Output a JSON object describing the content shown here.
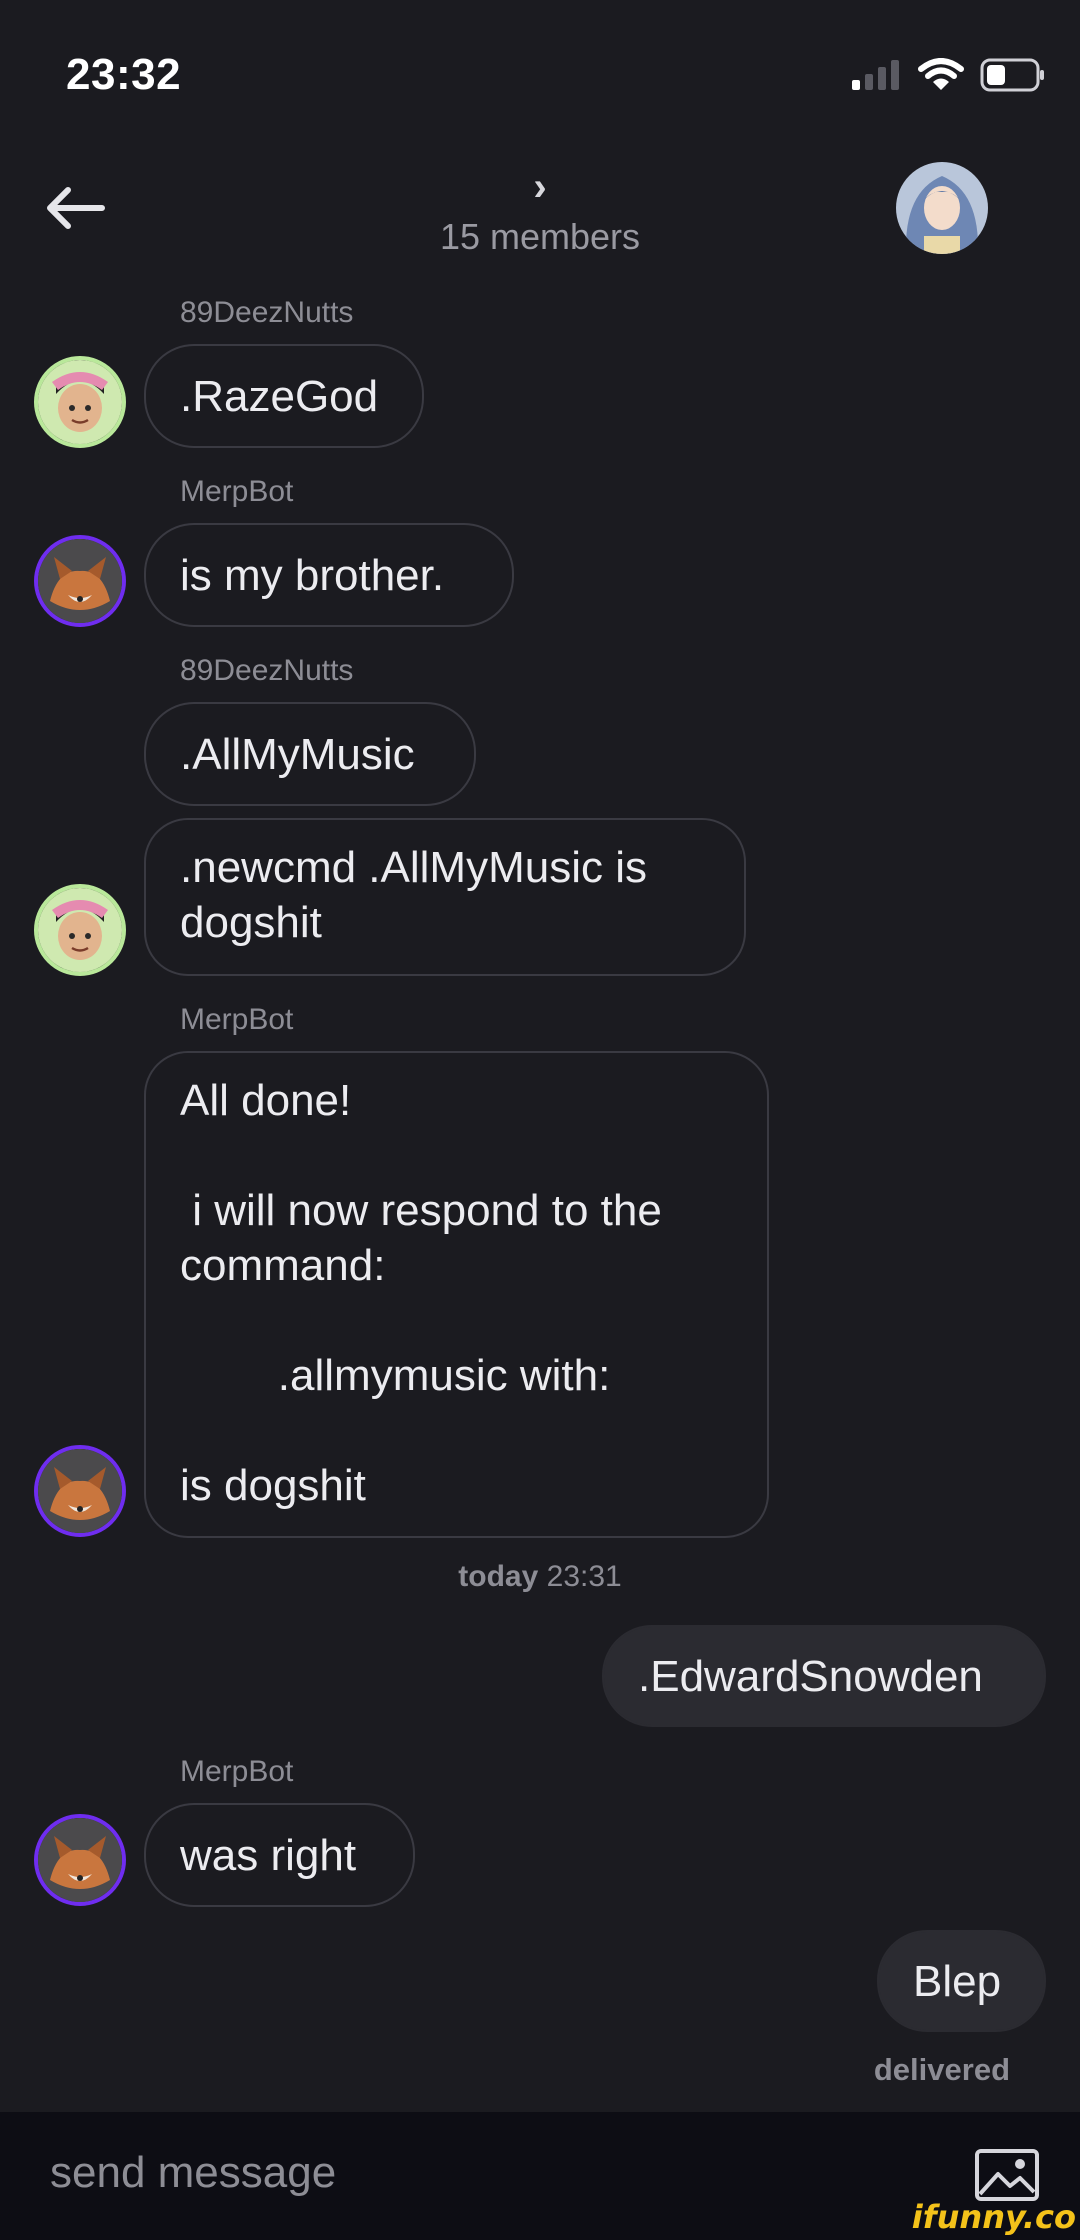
{
  "status_bar": {
    "time": "23:32"
  },
  "header": {
    "chevron": "›",
    "subtitle": "15 members"
  },
  "messages": [
    {
      "sender": "89DeezNutts",
      "lines": ".RazeGod"
    },
    {
      "sender": "MerpBot",
      "lines": "is my brother."
    },
    {
      "sender": "89DeezNutts",
      "lines": ".AllMyMusic"
    },
    {
      "sender": "",
      "lines": ".newcmd .AllMyMusic is\ndogshit"
    },
    {
      "sender": "MerpBot",
      "lines": "All done!\n\n i will now respond to the\ncommand:\n\n        .allmymusic with:\n\nis dogshit"
    },
    {
      "sender": "me",
      "lines": ".EdwardSnowden"
    },
    {
      "sender": "MerpBot",
      "lines": "was right"
    },
    {
      "sender": "me",
      "lines": "Blep"
    }
  ],
  "timestamp": {
    "day": "today",
    "time": "23:31"
  },
  "delivered": "delivered",
  "composer": {
    "placeholder": "send message"
  },
  "watermark": "ifunny.co",
  "colors": {
    "background": "#1b1b20",
    "bubble_border": "#3a3a42",
    "own_bubble": "#2b2b31",
    "composer": "#0d0d14",
    "fox_ring": "#6f2df0",
    "watermark": "#f4c21a"
  },
  "icons": [
    "signal-icon",
    "wifi-icon",
    "battery-icon",
    "back-arrow-icon",
    "image-icon"
  ]
}
